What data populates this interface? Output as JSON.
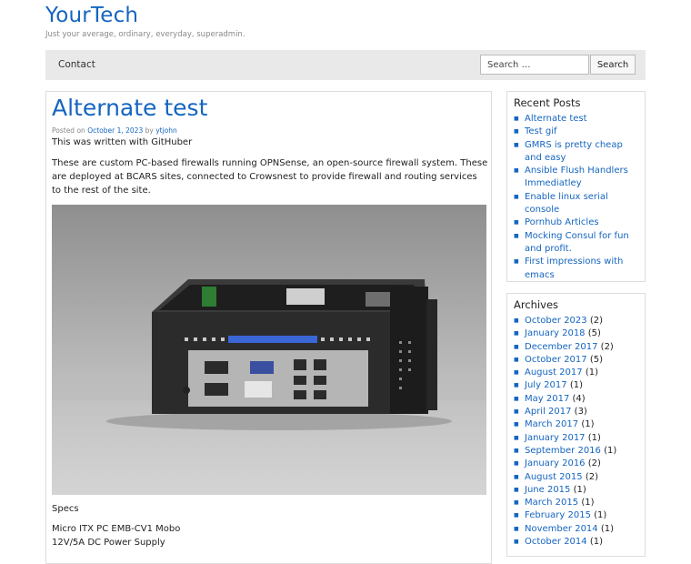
{
  "site": {
    "title": "YourTech",
    "tagline": "Just your average, ordinary, everyday, superadmin."
  },
  "nav": {
    "items": [
      "Contact"
    ]
  },
  "search": {
    "placeholder": "Search …",
    "button_label": "Search"
  },
  "post": {
    "title": "Alternate test",
    "meta_prefix": "Posted on",
    "date": "October 1, 2023",
    "by": "by",
    "author": "ytjohn",
    "paragraph1": "This was written with GitHuber",
    "paragraph2": "These are custom PC-based firewalls running OPNSense, an open-source firewall system. These are deployed at BCARS sites, connected to Crowsnest to provide firewall and routing services to the rest of the site.",
    "specs_label": "Specs",
    "specs": [
      "Micro ITX PC EMB-CV1 Mobo",
      "12V/5A DC Power Supply"
    ]
  },
  "recent_posts": {
    "title": "Recent Posts",
    "items": [
      "Alternate test",
      "Test gif",
      "GMRS is pretty cheap and easy",
      "Ansible Flush Handlers Immediatley",
      "Enable linux serial console",
      "Pornhub Articles",
      "Mocking Consul for fun and profit.",
      "First impressions with emacs"
    ]
  },
  "archives": {
    "title": "Archives",
    "items": [
      {
        "label": "October 2023",
        "count": "(2)"
      },
      {
        "label": "January 2018",
        "count": "(5)"
      },
      {
        "label": "December 2017",
        "count": "(2)"
      },
      {
        "label": "October 2017",
        "count": "(5)"
      },
      {
        "label": "August 2017",
        "count": "(1)"
      },
      {
        "label": "July 2017",
        "count": "(1)"
      },
      {
        "label": "May 2017",
        "count": "(4)"
      },
      {
        "label": "April 2017",
        "count": "(3)"
      },
      {
        "label": "March 2017",
        "count": "(1)"
      },
      {
        "label": "January 2017",
        "count": "(1)"
      },
      {
        "label": "September 2016",
        "count": "(1)"
      },
      {
        "label": "January 2016",
        "count": "(2)"
      },
      {
        "label": "August 2015",
        "count": "(2)"
      },
      {
        "label": "June 2015",
        "count": "(1)"
      },
      {
        "label": "March 2015",
        "count": "(1)"
      },
      {
        "label": "February 2015",
        "count": "(1)"
      },
      {
        "label": "November 2014",
        "count": "(1)"
      },
      {
        "label": "October 2014",
        "count": "(1)"
      }
    ]
  },
  "colors": {
    "link": "#1565c0",
    "nav_bg": "#e9e9e9"
  }
}
